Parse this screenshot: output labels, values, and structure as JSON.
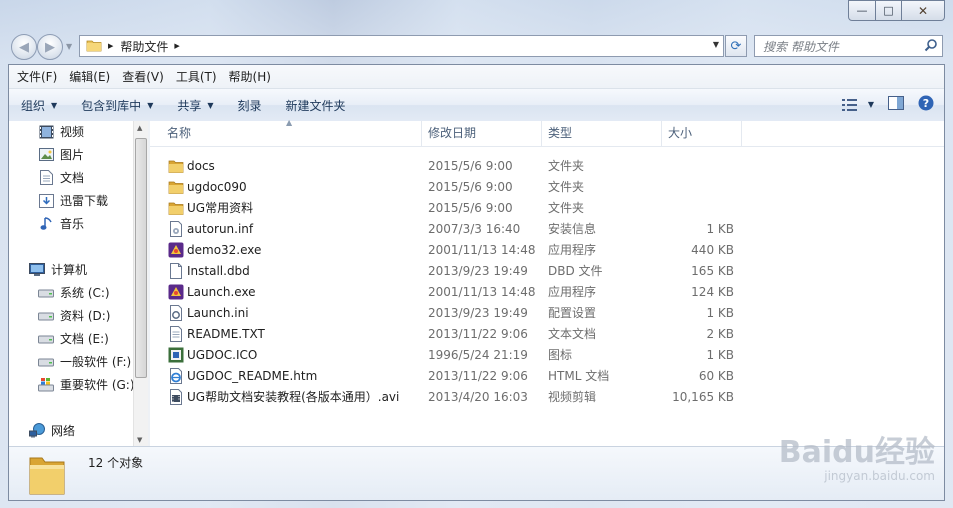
{
  "window": {
    "caption_buttons": {
      "minimize": "—",
      "maximize": "□",
      "close": "✕"
    }
  },
  "navbar": {
    "breadcrumb": [
      "帮助文件"
    ],
    "search_placeholder": "搜索 帮助文件"
  },
  "menubar": {
    "items": [
      "文件(F)",
      "编辑(E)",
      "查看(V)",
      "工具(T)",
      "帮助(H)"
    ]
  },
  "toolbar": {
    "organize": "组织",
    "include_in_library": "包含到库中",
    "share": "共享",
    "burn": "刻录",
    "new_folder": "新建文件夹"
  },
  "sidebar": {
    "items": [
      {
        "label": "视频",
        "icon": "video-library-icon"
      },
      {
        "label": "图片",
        "icon": "picture-library-icon"
      },
      {
        "label": "文档",
        "icon": "document-library-icon"
      },
      {
        "label": "迅雷下载",
        "icon": "download-library-icon"
      },
      {
        "label": "音乐",
        "icon": "music-library-icon"
      },
      {
        "label": "计算机",
        "icon": "computer-icon"
      },
      {
        "label": "系统 (C:)",
        "icon": "drive-icon"
      },
      {
        "label": "资料 (D:)",
        "icon": "drive-icon"
      },
      {
        "label": "文档 (E:)",
        "icon": "drive-icon"
      },
      {
        "label": "一般软件 (F:)",
        "icon": "drive-icon"
      },
      {
        "label": "重要软件 (G:)",
        "icon": "windows-drive-icon"
      },
      {
        "label": "网络",
        "icon": "network-icon"
      }
    ]
  },
  "columns": {
    "name": "名称",
    "date": "修改日期",
    "type": "类型",
    "size": "大小"
  },
  "files": [
    {
      "name": "docs",
      "date": "2015/5/6 9:00",
      "type": "文件夹",
      "size": "",
      "icon": "folder-icon"
    },
    {
      "name": "ugdoc090",
      "date": "2015/5/6 9:00",
      "type": "文件夹",
      "size": "",
      "icon": "folder-icon"
    },
    {
      "name": "UG常用资料",
      "date": "2015/5/6 9:00",
      "type": "文件夹",
      "size": "",
      "icon": "folder-icon"
    },
    {
      "name": "autorun.inf",
      "date": "2007/3/3 16:40",
      "type": "安装信息",
      "size": "1 KB",
      "icon": "inf-file-icon"
    },
    {
      "name": "demo32.exe",
      "date": "2001/11/13 14:48",
      "type": "应用程序",
      "size": "440 KB",
      "icon": "app-icon"
    },
    {
      "name": "Install.dbd",
      "date": "2013/9/23 19:49",
      "type": "DBD 文件",
      "size": "165 KB",
      "icon": "blank-file-icon"
    },
    {
      "name": "Launch.exe",
      "date": "2001/11/13 14:48",
      "type": "应用程序",
      "size": "124 KB",
      "icon": "app-icon"
    },
    {
      "name": "Launch.ini",
      "date": "2013/9/23 19:49",
      "type": "配置设置",
      "size": "1 KB",
      "icon": "ini-file-icon"
    },
    {
      "name": "README.TXT",
      "date": "2013/11/22 9:06",
      "type": "文本文档",
      "size": "2 KB",
      "icon": "text-file-icon"
    },
    {
      "name": "UGDOC.ICO",
      "date": "1996/5/24 21:19",
      "type": "图标",
      "size": "1 KB",
      "icon": "ico-file-icon"
    },
    {
      "name": "UGDOC_README.htm",
      "date": "2013/11/22 9:06",
      "type": "HTML 文档",
      "size": "60 KB",
      "icon": "html-file-icon"
    },
    {
      "name": "UG帮助文档安装教程(各版本通用）.avi",
      "date": "2013/4/20 16:03",
      "type": "视频剪辑",
      "size": "10,165 KB",
      "icon": "video-file-icon"
    }
  ],
  "status": {
    "item_count": "12 个对象"
  },
  "watermark": {
    "brand": "Baidu经验",
    "url": "jingyan.baidu.com"
  }
}
